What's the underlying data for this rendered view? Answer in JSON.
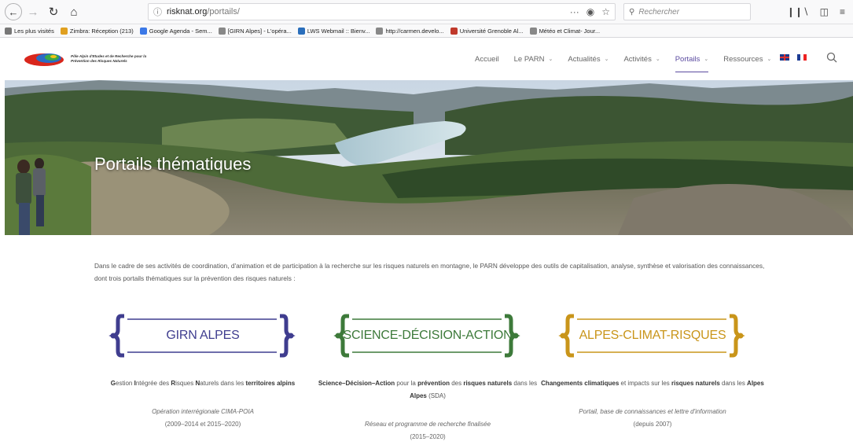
{
  "browser": {
    "url_host": "risknat.org",
    "url_path": "/portails/",
    "url_more": "···",
    "search_placeholder": "Rechercher",
    "bookmarks": [
      {
        "label": "Les plus visités",
        "color": "#777"
      },
      {
        "label": "Zimbra: Réception (213)",
        "color": "#e0a020"
      },
      {
        "label": "Google Agenda - Sem...",
        "color": "#3b78e7"
      },
      {
        "label": "[GIRN Alpes] - L'opéra...",
        "color": "#888"
      },
      {
        "label": "LWS Webmail :: Bienv...",
        "color": "#2a6ebb"
      },
      {
        "label": "http://carmen.develo...",
        "color": "#888"
      },
      {
        "label": "Université Grenoble Al...",
        "color": "#c0392b"
      },
      {
        "label": "Météo et Climat- Jour...",
        "color": "#888"
      }
    ]
  },
  "site": {
    "logo_text": "Pôle Alpin d'Etudes et de Recherche pour la Prévention des Risques Naturels",
    "nav": [
      {
        "label": "Accueil",
        "has_menu": false,
        "active": false
      },
      {
        "label": "Le PARN",
        "has_menu": true,
        "active": false
      },
      {
        "label": "Actualités",
        "has_menu": true,
        "active": false
      },
      {
        "label": "Activités",
        "has_menu": true,
        "active": false
      },
      {
        "label": "Portails",
        "has_menu": true,
        "active": true
      },
      {
        "label": "Ressources",
        "has_menu": true,
        "active": false
      }
    ],
    "accent_color": "#5b4ba0"
  },
  "hero": {
    "title": "Portails thématiques"
  },
  "intro": "Dans le cadre de ses activités de coordination, d'animation et de participation à la recherche sur les risques naturels en montagne, le PARN développe des outils de capitalisation, analyse, synthèse et valorisation des connaissances, dont trois portails thématiques sur la prévention des risques naturels :",
  "portals": [
    {
      "label": "GIRN ALPES",
      "color": "#3f3d8f",
      "desc_parts": [
        [
          "G",
          true
        ],
        [
          "estion ",
          false
        ],
        [
          "I",
          true
        ],
        [
          "ntégrée des ",
          false
        ],
        [
          "R",
          true
        ],
        [
          "isques ",
          false
        ],
        [
          "N",
          true
        ],
        [
          "aturels dans les ",
          false
        ],
        [
          "territoires alpins",
          true
        ]
      ],
      "sub_italic": "Opération interrégionale CIMA-POIA",
      "sub_dates": "(2009–2014 et 2015–2020)"
    },
    {
      "label": "SCIENCE-DÉCISION-ACTION",
      "color": "#3d7a3a",
      "desc_parts": [
        [
          "Science–Décision–Action",
          true
        ],
        [
          " pour la ",
          false
        ],
        [
          "prévention",
          true
        ],
        [
          " des ",
          false
        ],
        [
          "risques naturels",
          true
        ],
        [
          " dans les ",
          false
        ],
        [
          "Alpes",
          true
        ],
        [
          " (SDA)",
          false
        ]
      ],
      "sub_italic": "Réseau et programme de recherche finalisée",
      "sub_dates": "(2015–2020)"
    },
    {
      "label": "ALPES-CLIMAT-RISQUES",
      "color": "#c9951a",
      "desc_parts": [
        [
          "Changements climatiques",
          true
        ],
        [
          " et impacts sur les ",
          false
        ],
        [
          "risques naturels",
          true
        ],
        [
          " dans les ",
          false
        ],
        [
          "Alpes",
          true
        ]
      ],
      "sub_italic": "Portail, base de connaissances et lettre d'information",
      "sub_dates": "(depuis 2007)"
    }
  ]
}
